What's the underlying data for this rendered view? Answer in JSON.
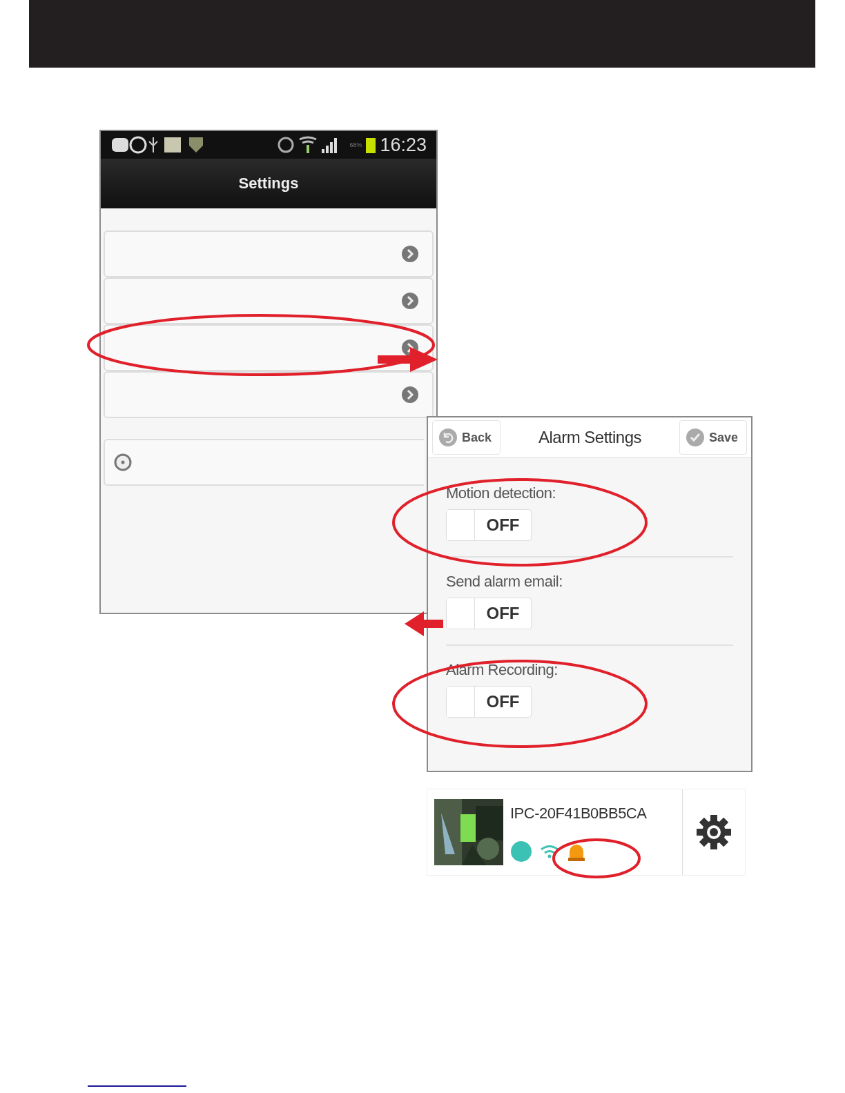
{
  "phone": {
    "status_bar": {
      "battery": "68%",
      "time": "16:23"
    },
    "title": "Settings",
    "rows": [
      {
        "kind": "chevron"
      },
      {
        "kind": "chevron"
      },
      {
        "kind": "chevron"
      },
      {
        "kind": "chevron"
      },
      {
        "kind": "radio"
      }
    ]
  },
  "alarm_settings": {
    "back": "Back",
    "title": "Alarm Settings",
    "save": "Save",
    "options": [
      {
        "label": "Motion detection:",
        "on": false,
        "value": "OFF"
      },
      {
        "label": "Send alarm email:",
        "on": false,
        "value": "OFF"
      },
      {
        "label": "Alarm Recording:",
        "on": false,
        "value": "OFF"
      }
    ]
  },
  "device": {
    "kind": "picture",
    "name": "IPC-20F41B0BB5CA"
  }
}
